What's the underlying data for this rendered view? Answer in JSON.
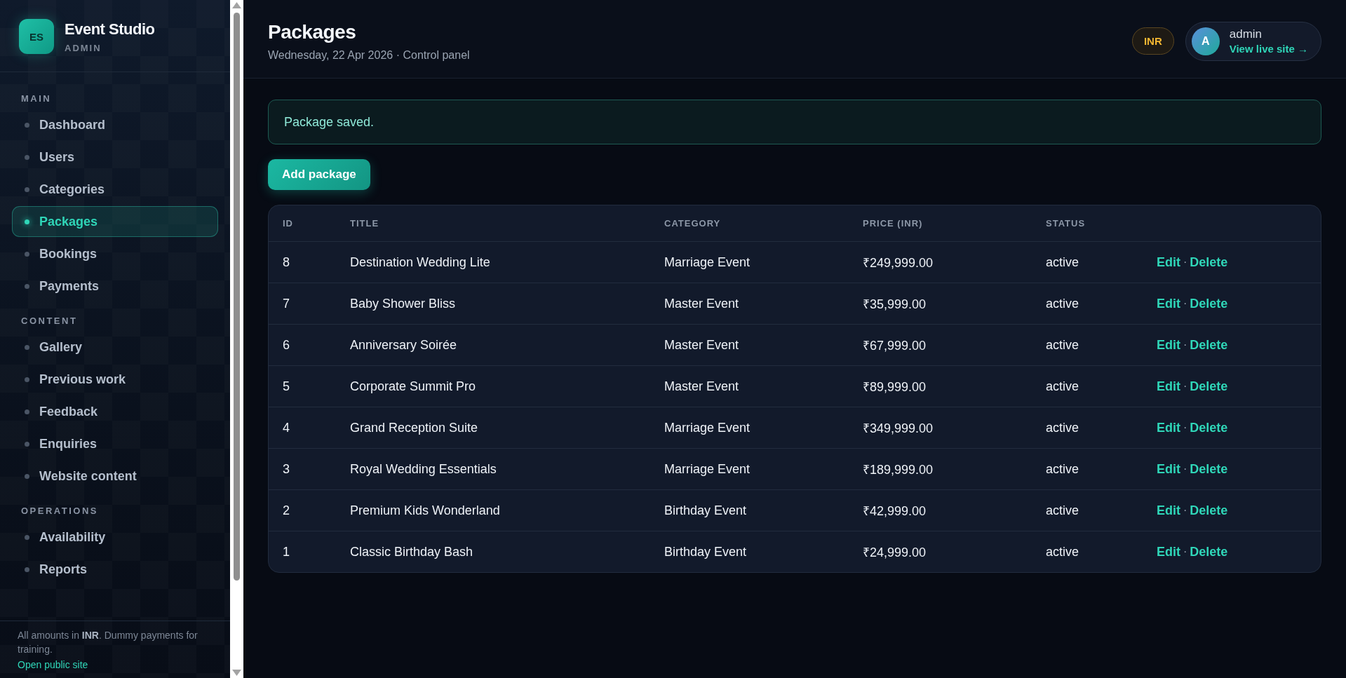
{
  "sidebar": {
    "logo": "ES",
    "brand": "Event Studio",
    "role": "ADMIN",
    "sections": [
      {
        "heading": "MAIN",
        "items": [
          {
            "label": "Dashboard",
            "selected": false
          },
          {
            "label": "Users",
            "selected": false
          },
          {
            "label": "Categories",
            "selected": false
          },
          {
            "label": "Packages",
            "selected": true
          },
          {
            "label": "Bookings",
            "selected": false
          },
          {
            "label": "Payments",
            "selected": false
          }
        ]
      },
      {
        "heading": "CONTENT",
        "items": [
          {
            "label": "Gallery",
            "selected": false
          },
          {
            "label": "Previous work",
            "selected": false
          },
          {
            "label": "Feedback",
            "selected": false
          },
          {
            "label": "Enquiries",
            "selected": false
          },
          {
            "label": "Website content",
            "selected": false
          }
        ]
      },
      {
        "heading": "OPERATIONS",
        "items": [
          {
            "label": "Availability",
            "selected": false
          },
          {
            "label": "Reports",
            "selected": false
          }
        ]
      }
    ],
    "footer": {
      "note": "All amounts in **INR**. Dummy payments for training.",
      "link": "Open public site"
    }
  },
  "header": {
    "title": "Packages",
    "subtitle": "Wednesday, 22 Apr 2026 · Control panel",
    "currency": "INR",
    "user": {
      "avatar": "A",
      "name": "admin",
      "link": "View live site →"
    }
  },
  "alert": "Package saved.",
  "add_button": "Add package",
  "table": {
    "columns": [
      "ID",
      "TITLE",
      "CATEGORY",
      "PRICE (INR)",
      "STATUS"
    ],
    "rows": [
      {
        "id": "8",
        "title": "Destination Wedding Lite",
        "category": "Marriage Event",
        "price": "₹249,999.00",
        "status": "active",
        "actions": {
          "edit": "Edit",
          "separator": "·",
          "delete": "Delete"
        }
      },
      {
        "id": "7",
        "title": "Baby Shower Bliss",
        "category": "Master Event",
        "price": "₹35,999.00",
        "status": "active",
        "actions": {
          "edit": "Edit",
          "separator": "·",
          "delete": "Delete"
        }
      },
      {
        "id": "6",
        "title": "Anniversary Soirée",
        "category": "Master Event",
        "price": "₹67,999.00",
        "status": "active",
        "actions": {
          "edit": "Edit",
          "separator": "·",
          "delete": "Delete"
        }
      },
      {
        "id": "5",
        "title": "Corporate Summit Pro",
        "category": "Master Event",
        "price": "₹89,999.00",
        "status": "active",
        "actions": {
          "edit": "Edit",
          "separator": "·",
          "delete": "Delete"
        }
      },
      {
        "id": "4",
        "title": "Grand Reception Suite",
        "category": "Marriage Event",
        "price": "₹349,999.00",
        "status": "active",
        "actions": {
          "edit": "Edit",
          "separator": "·",
          "delete": "Delete"
        }
      },
      {
        "id": "3",
        "title": "Royal Wedding Essentials",
        "category": "Marriage Event",
        "price": "₹189,999.00",
        "status": "active",
        "actions": {
          "edit": "Edit",
          "separator": "·",
          "delete": "Delete"
        }
      },
      {
        "id": "2",
        "title": "Premium Kids Wonderland",
        "category": "Birthday Event",
        "price": "₹42,999.00",
        "status": "active",
        "actions": {
          "edit": "Edit",
          "separator": "·",
          "delete": "Delete"
        }
      },
      {
        "id": "1",
        "title": "Classic Birthday Bash",
        "category": "Birthday Event",
        "price": "₹24,999.00",
        "status": "active",
        "actions": {
          "edit": "Edit",
          "separator": "·",
          "delete": "Delete"
        }
      }
    ]
  }
}
